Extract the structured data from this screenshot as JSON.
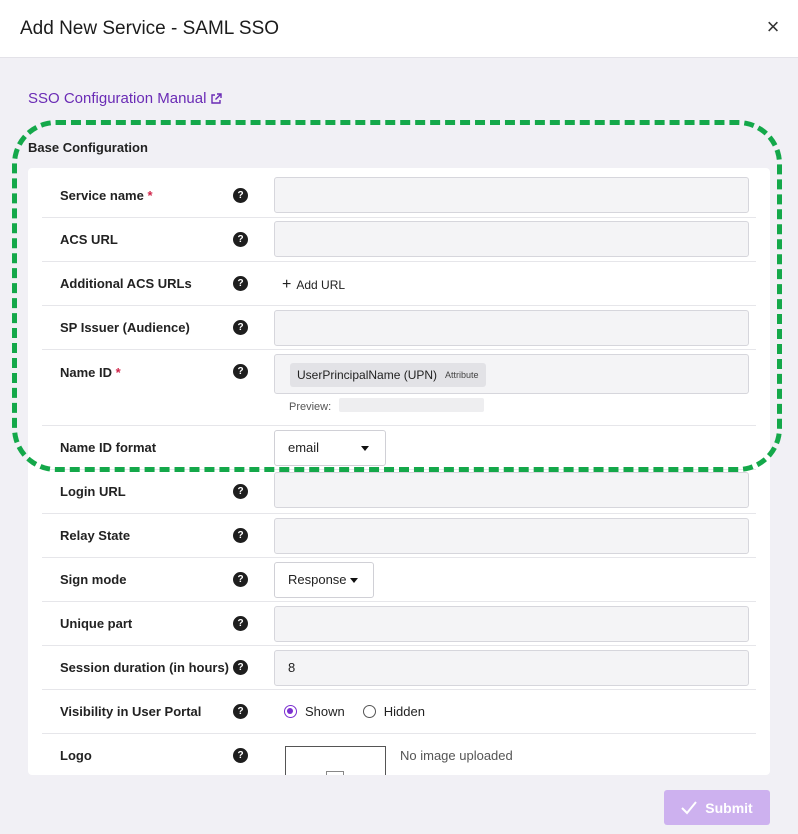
{
  "dialog": {
    "title": "Add New Service - SAML SSO",
    "close_glyph": "×"
  },
  "manual_link": {
    "label": "SSO Configuration Manual",
    "icon": "external-link-icon"
  },
  "section": {
    "title": "Base Configuration"
  },
  "form": {
    "service_name": {
      "label": "Service name",
      "required_mark": "*",
      "value": ""
    },
    "acs_url": {
      "label": "ACS URL",
      "value": ""
    },
    "additional_acs_urls": {
      "label": "Additional ACS URLs",
      "add_label": "Add URL"
    },
    "sp_issuer": {
      "label": "SP Issuer (Audience)",
      "value": ""
    },
    "name_id": {
      "label": "Name ID",
      "required_mark": "*",
      "chip_value": "UserPrincipalName (UPN)",
      "chip_type": "Attribute",
      "preview_label": "Preview:"
    },
    "name_id_format": {
      "label": "Name ID format",
      "selected": "email"
    },
    "login_url": {
      "label": "Login URL",
      "value": ""
    },
    "relay_state": {
      "label": "Relay State",
      "value": ""
    },
    "sign_mode": {
      "label": "Sign mode",
      "selected": "Response"
    },
    "unique_part": {
      "label": "Unique part",
      "value": ""
    },
    "session_duration": {
      "label": "Session duration (in hours)",
      "value": "8"
    },
    "visibility": {
      "label": "Visibility in User Portal",
      "options": [
        "Shown",
        "Hidden"
      ],
      "selected": "Shown"
    },
    "logo": {
      "label": "Logo",
      "status": "No image uploaded"
    }
  },
  "help_glyph": "?",
  "submit": {
    "label": "Submit"
  },
  "colors": {
    "accent": "#7b2fd0",
    "link": "#6a2bb5",
    "highlight": "#14a84a",
    "submit_bg": "#cdb1ef",
    "required": "#d0254a"
  }
}
